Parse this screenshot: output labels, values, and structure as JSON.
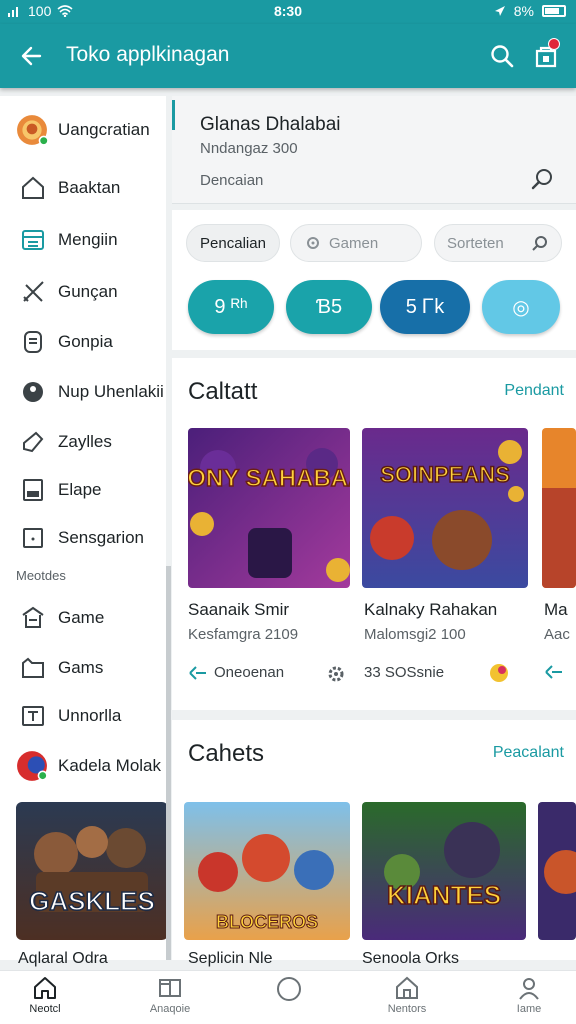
{
  "status": {
    "left_text": "100",
    "time": "8:30",
    "battery_text": "8%"
  },
  "appbar": {
    "title": "Toko applkinagan"
  },
  "sidebar": {
    "items": [
      {
        "label": "Uangcratian",
        "icon": "avatar-icon"
      },
      {
        "label": "Baaktan",
        "icon": "home-icon"
      },
      {
        "label": "Mengiin",
        "icon": "list-icon"
      },
      {
        "label": "Gunçan",
        "icon": "swords-icon"
      },
      {
        "label": "Gonpia",
        "icon": "document-icon"
      },
      {
        "label": "Nup Uhenlakii",
        "icon": "tag-icon"
      },
      {
        "label": "Zaylles",
        "icon": "edit-icon"
      },
      {
        "label": "Elape",
        "icon": "tablet-icon"
      },
      {
        "label": "Sensgarion",
        "icon": "frame-icon"
      }
    ],
    "section_label": "Meotdes",
    "items2": [
      {
        "label": "Game",
        "icon": "store-icon"
      },
      {
        "label": "Gams",
        "icon": "folder-icon"
      },
      {
        "label": "Unnorlla",
        "icon": "text-box-icon"
      },
      {
        "label": "Kadela Molak",
        "icon": "avatar-icon"
      }
    ],
    "game_card_text": "GASKLES"
  },
  "header_card": {
    "title": "Glanas Dhalabai",
    "subtitle": "Nndangaz 300",
    "search_text": "Dencaian"
  },
  "filters": {
    "chips": [
      {
        "label": "Pencalian"
      },
      {
        "label": "Gamen"
      },
      {
        "label": "Sorteten"
      }
    ],
    "pills": [
      {
        "label": "9 ᴿʰ",
        "color": "#1aa3aa"
      },
      {
        "label": "Ɓ5",
        "color": "#1aa3aa"
      },
      {
        "label": "5 Ꮁk",
        "color": "#176fa8"
      },
      {
        "label": "◎",
        "color": "#62c8e6"
      }
    ]
  },
  "section1": {
    "title": "Caltatt",
    "link": "Pendant",
    "games": [
      {
        "art_text": "FONY SAHABAA",
        "name": "Saanaik Smir",
        "sub": "Kesfamgra 2109",
        "meta": "Oneoenan"
      },
      {
        "art_text": "SOINPEANS",
        "name": "Kalnaky Rahakan",
        "sub": "Malomsgi2 100",
        "meta": "33 SOSsnie"
      },
      {
        "art_text": "",
        "name": "Ma",
        "sub": "Aac",
        "meta": ""
      }
    ]
  },
  "section2": {
    "title": "Cahets",
    "link": "Peacalant",
    "games": [
      {
        "art_text": "BLOCEROS",
        "name": "Seplicin Nle"
      },
      {
        "art_text": "KIANTES",
        "name": "Senoola Orks"
      }
    ]
  },
  "bottom_strip": {
    "left": "Aqlaral Odra"
  },
  "bottomnav": [
    {
      "label": "Neotcl",
      "icon": "home-icon"
    },
    {
      "label": "Anaqoie",
      "icon": "book-icon"
    },
    {
      "label": "",
      "icon": "circle-icon"
    },
    {
      "label": "Nentors",
      "icon": "house-icon"
    },
    {
      "label": "Iame",
      "icon": "person-icon"
    }
  ]
}
